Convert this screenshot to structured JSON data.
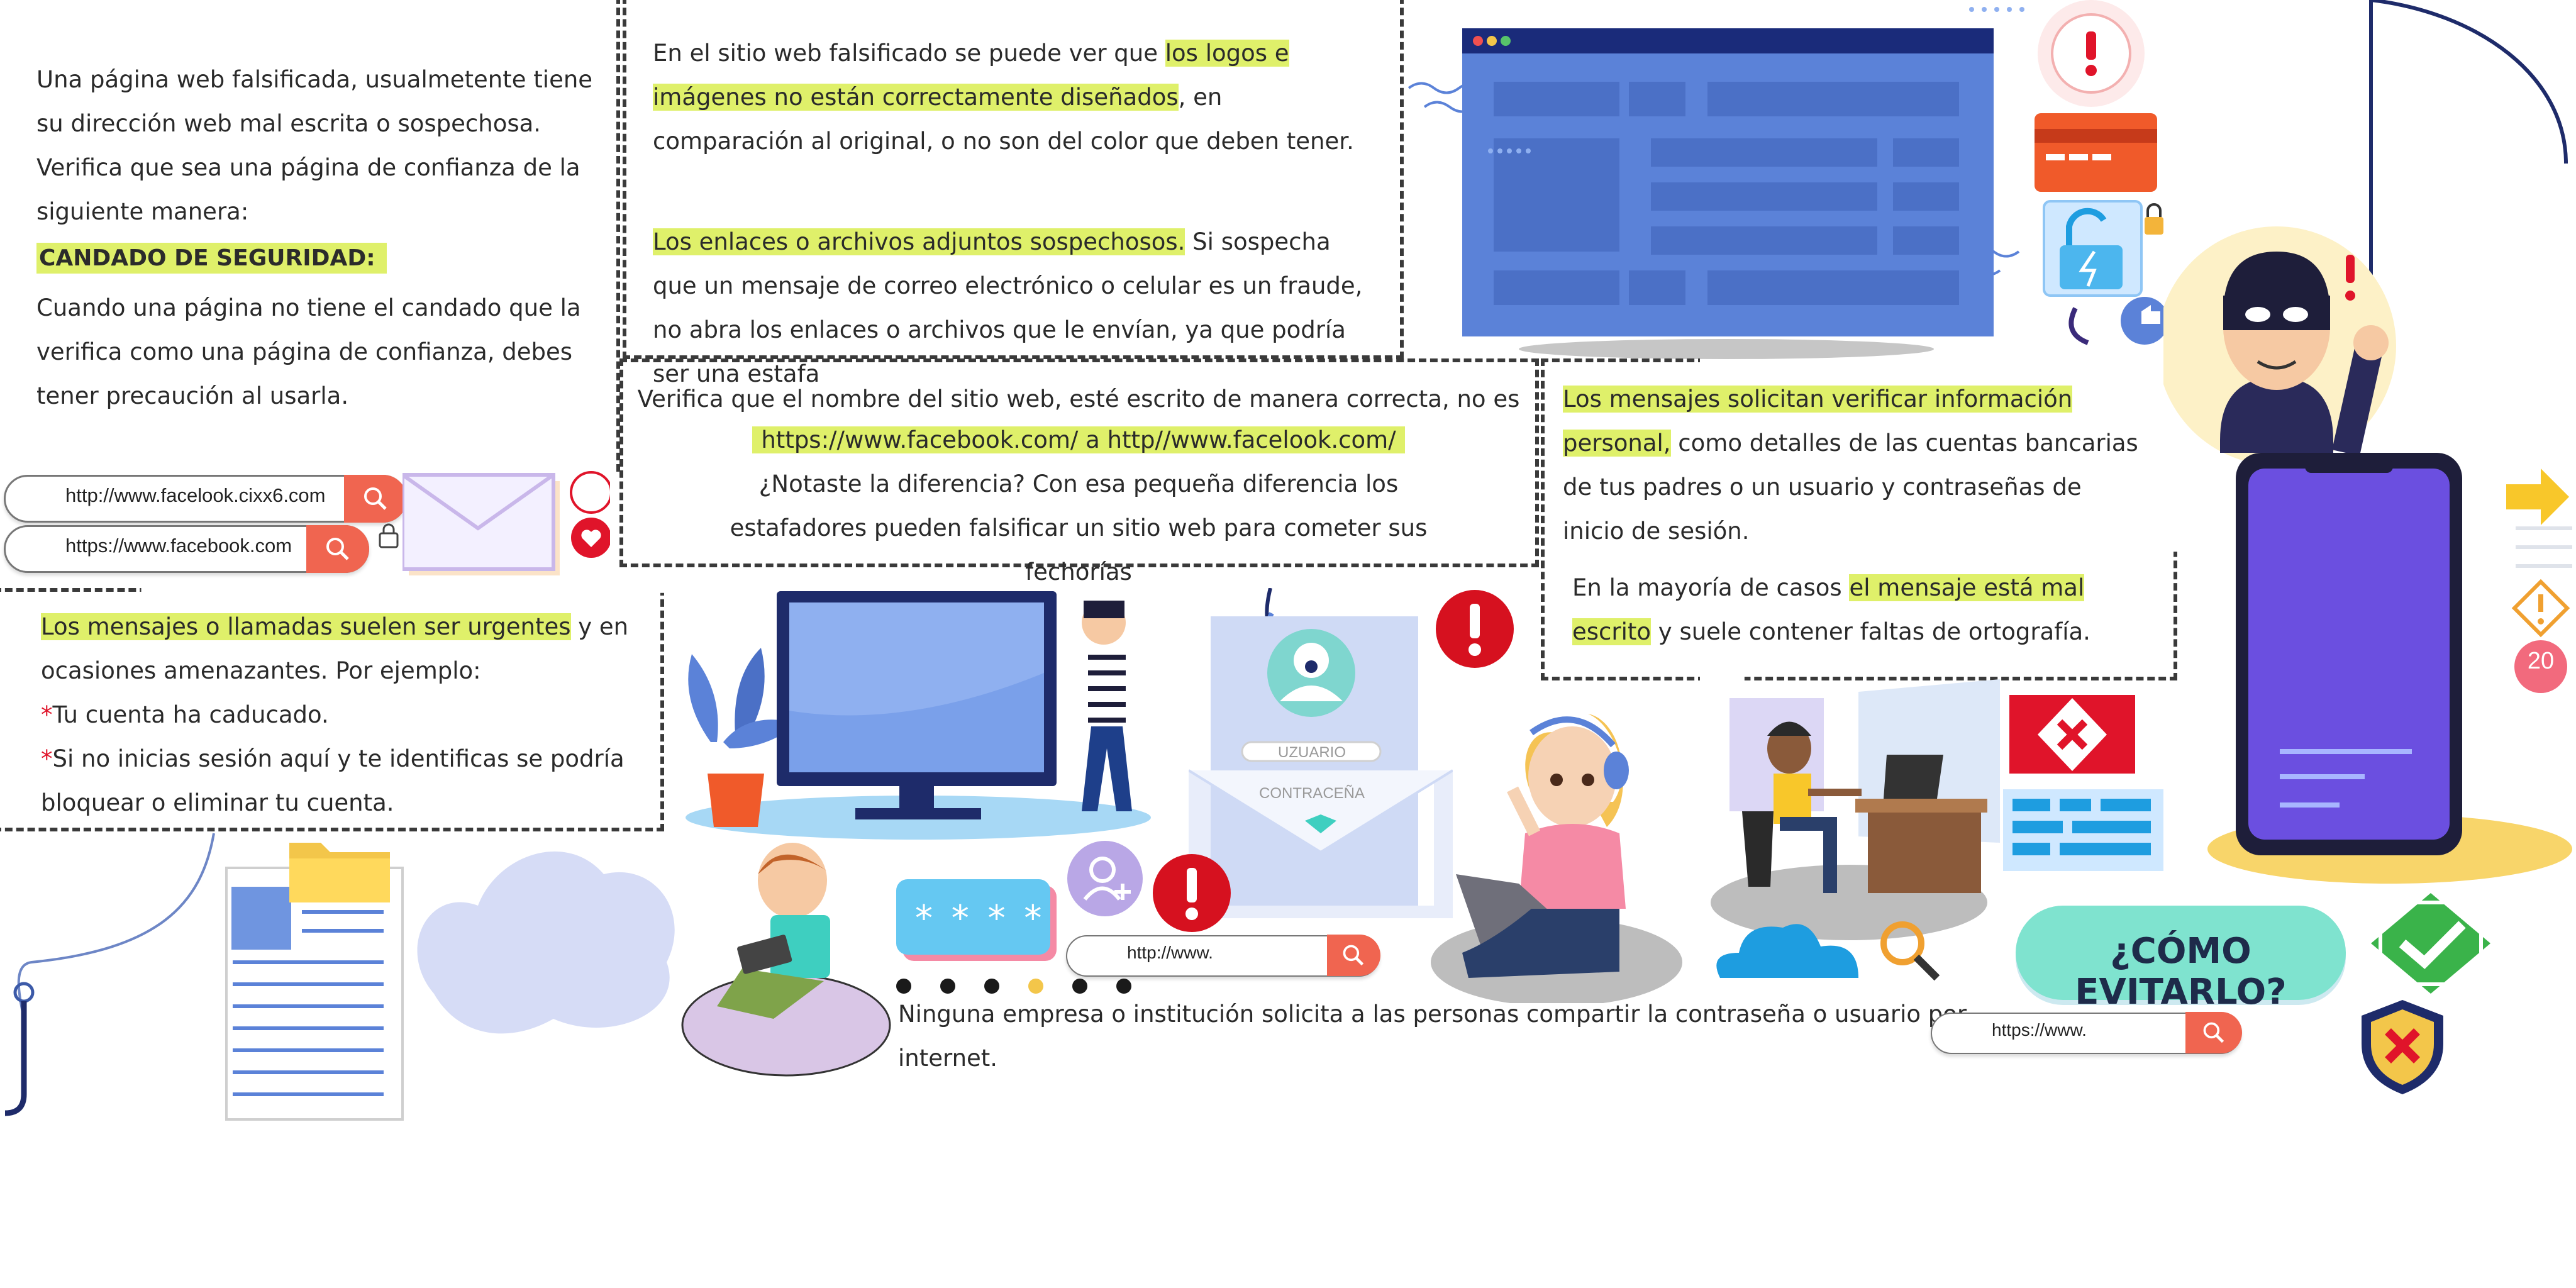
{
  "block1": {
    "intro": "Una página web falsificada, usualmetente tiene su dirección web mal escrita o sospechosa. Verifica que sea una página de confianza de la siguiente manera:",
    "heading": "CANDADO DE SEGURIDAD:",
    "body": "Cuando una página no tiene el candado que la verifica como una página de confianza, debes tener precaución al usarla."
  },
  "url_examples": {
    "fake": "http://www.facelook.cixx6.com",
    "real": "https://www.facebook.com"
  },
  "block2": {
    "prefix": "En el sitio web falsificado se puede ver que ",
    "highlight": "los logos e imágenes no están correctamente diseñados",
    "suffix": ", en comparación al original, o no son del color que deben tener."
  },
  "block3": {
    "highlight": "Los enlaces o archivos adjuntos sospechosos.",
    "suffix": " Si sospecha que un mensaje de correo electrónico o celular es un fraude, no abra los enlaces o archivos que le envían, ya que podría ser una estafa"
  },
  "block4": {
    "line1": "Verifica que el nombre del sitio web, esté escrito de manera correcta, no es lo mismo:",
    "compare": "https://www.facebook.com/ a http//www.facelook.com/",
    "line3": "¿Notaste la diferencia? Con esa pequeña diferencia los estafadores pueden falsificar un sitio web para cometer sus fechorías"
  },
  "block5": {
    "highlight": "Los mensajes solicitan verificar información personal,",
    "suffix": " como detalles de las cuentas bancarias de tus padres o un usuario y contraseñas de inicio de sesión."
  },
  "block6": {
    "prefix": "En la mayoría de casos ",
    "highlight": "el mensaje está mal escrito",
    "suffix": " y suele contener faltas de ortografía."
  },
  "block7": {
    "highlight": "Los mensajes o llamadas suelen ser urgentes",
    "suffix": " y en ocasiones amenazantes. Por ejemplo:",
    "ex1": "Tu cuenta ha caducado.",
    "ex2": "Si no inicias sesión aquí y te identificas se podría bloquear o eliminar tu cuenta."
  },
  "envelope": {
    "user_label": "UZUARIO",
    "pass_label": "CONTRACEÑA"
  },
  "password_mask": "* * * *",
  "url_small": "http://www.",
  "url_right": "https://www.",
  "footer_note": "Ninguna empresa o institución solicita a las personas compartir la contraseña o usuario por internet.",
  "how_avoid": "¿CÓMO EVITARLO?",
  "notif_count": "20",
  "colors": {
    "highlight": "#dff06a",
    "accent_red": "#e0142a",
    "search_orange": "#f06550",
    "browser_blue": "#5b82d8",
    "phone_purple": "#6b4fe0",
    "teal_bubble": "#7fe3cf"
  }
}
